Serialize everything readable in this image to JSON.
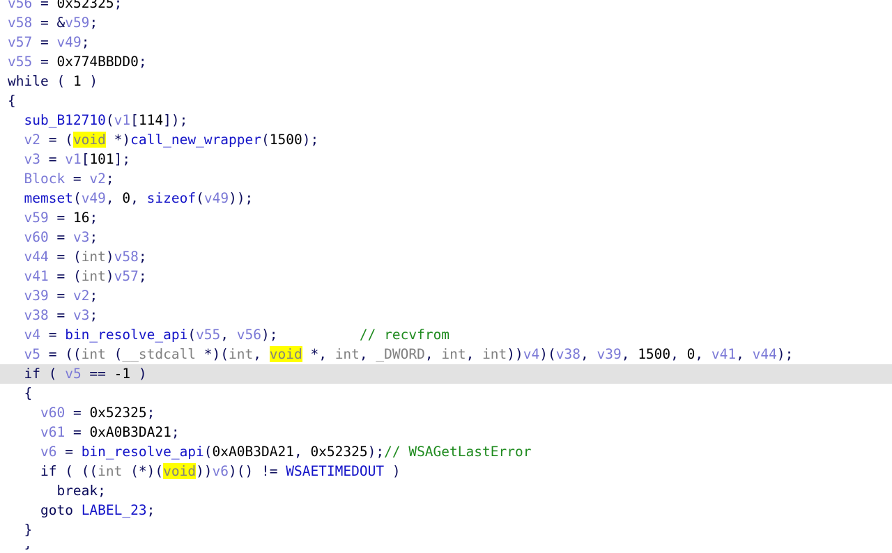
{
  "app": {
    "view_name": "hex-rays-pseudocode",
    "background": "#ffffff",
    "current_line_highlight": "#e2e2e2",
    "match_highlight": "#ffff00",
    "colors": {
      "variable": "#7a78d6",
      "function": "#1414c8",
      "keyword": "#0a0a5a",
      "type": "#808080",
      "number": "#000000",
      "comment": "#1f8b1f",
      "constant": "#1414c8"
    }
  },
  "code": {
    "highlighted_token": "void",
    "current_line_index": 19,
    "lines": [
      {
        "indent": 0,
        "clipped_top": true,
        "tokens": [
          {
            "t": "v56",
            "c": "var"
          },
          {
            "t": " = ",
            "c": "punct"
          },
          {
            "t": "0x52325",
            "c": "num"
          },
          {
            "t": ";",
            "c": "punct"
          }
        ]
      },
      {
        "indent": 0,
        "tokens": [
          {
            "t": "v58",
            "c": "var"
          },
          {
            "t": " = &",
            "c": "punct"
          },
          {
            "t": "v59",
            "c": "var"
          },
          {
            "t": ";",
            "c": "punct"
          }
        ]
      },
      {
        "indent": 0,
        "tokens": [
          {
            "t": "v57",
            "c": "var"
          },
          {
            "t": " = ",
            "c": "punct"
          },
          {
            "t": "v49",
            "c": "var"
          },
          {
            "t": ";",
            "c": "punct"
          }
        ]
      },
      {
        "indent": 0,
        "tokens": [
          {
            "t": "v55",
            "c": "var"
          },
          {
            "t": " = ",
            "c": "punct"
          },
          {
            "t": "0x774BBDD0",
            "c": "num"
          },
          {
            "t": ";",
            "c": "punct"
          }
        ]
      },
      {
        "indent": 0,
        "tokens": [
          {
            "t": "while",
            "c": "keyword"
          },
          {
            "t": " ( ",
            "c": "punct"
          },
          {
            "t": "1",
            "c": "num"
          },
          {
            "t": " )",
            "c": "punct"
          }
        ]
      },
      {
        "indent": 0,
        "tokens": [
          {
            "t": "{",
            "c": "punct"
          }
        ]
      },
      {
        "indent": 2,
        "tokens": [
          {
            "t": "sub_B12710",
            "c": "func"
          },
          {
            "t": "(",
            "c": "punct"
          },
          {
            "t": "v1",
            "c": "var"
          },
          {
            "t": "[",
            "c": "punct"
          },
          {
            "t": "114",
            "c": "num"
          },
          {
            "t": "]);",
            "c": "punct"
          }
        ]
      },
      {
        "indent": 2,
        "tokens": [
          {
            "t": "v2",
            "c": "var"
          },
          {
            "t": " = (",
            "c": "punct"
          },
          {
            "t": "void",
            "c": "type",
            "hl": true
          },
          {
            "t": " *)",
            "c": "punct"
          },
          {
            "t": "call_new_wrapper",
            "c": "func"
          },
          {
            "t": "(",
            "c": "punct"
          },
          {
            "t": "1500",
            "c": "num"
          },
          {
            "t": ");",
            "c": "punct"
          }
        ]
      },
      {
        "indent": 2,
        "tokens": [
          {
            "t": "v3",
            "c": "var"
          },
          {
            "t": " = ",
            "c": "punct"
          },
          {
            "t": "v1",
            "c": "var"
          },
          {
            "t": "[",
            "c": "punct"
          },
          {
            "t": "101",
            "c": "num"
          },
          {
            "t": "];",
            "c": "punct"
          }
        ]
      },
      {
        "indent": 2,
        "tokens": [
          {
            "t": "Block",
            "c": "var"
          },
          {
            "t": " = ",
            "c": "punct"
          },
          {
            "t": "v2",
            "c": "var"
          },
          {
            "t": ";",
            "c": "punct"
          }
        ]
      },
      {
        "indent": 2,
        "tokens": [
          {
            "t": "memset",
            "c": "func"
          },
          {
            "t": "(",
            "c": "punct"
          },
          {
            "t": "v49",
            "c": "var"
          },
          {
            "t": ", ",
            "c": "punct"
          },
          {
            "t": "0",
            "c": "num"
          },
          {
            "t": ", ",
            "c": "punct"
          },
          {
            "t": "sizeof",
            "c": "func"
          },
          {
            "t": "(",
            "c": "punct"
          },
          {
            "t": "v49",
            "c": "var"
          },
          {
            "t": "));",
            "c": "punct"
          }
        ]
      },
      {
        "indent": 2,
        "tokens": [
          {
            "t": "v59",
            "c": "var"
          },
          {
            "t": " = ",
            "c": "punct"
          },
          {
            "t": "16",
            "c": "num"
          },
          {
            "t": ";",
            "c": "punct"
          }
        ]
      },
      {
        "indent": 2,
        "tokens": [
          {
            "t": "v60",
            "c": "var"
          },
          {
            "t": " = ",
            "c": "punct"
          },
          {
            "t": "v3",
            "c": "var"
          },
          {
            "t": ";",
            "c": "punct"
          }
        ]
      },
      {
        "indent": 2,
        "tokens": [
          {
            "t": "v44",
            "c": "var"
          },
          {
            "t": " = (",
            "c": "punct"
          },
          {
            "t": "int",
            "c": "type"
          },
          {
            "t": ")",
            "c": "punct"
          },
          {
            "t": "v58",
            "c": "var"
          },
          {
            "t": ";",
            "c": "punct"
          }
        ]
      },
      {
        "indent": 2,
        "tokens": [
          {
            "t": "v41",
            "c": "var"
          },
          {
            "t": " = (",
            "c": "punct"
          },
          {
            "t": "int",
            "c": "type"
          },
          {
            "t": ")",
            "c": "punct"
          },
          {
            "t": "v57",
            "c": "var"
          },
          {
            "t": ";",
            "c": "punct"
          }
        ]
      },
      {
        "indent": 2,
        "tokens": [
          {
            "t": "v39",
            "c": "var"
          },
          {
            "t": " = ",
            "c": "punct"
          },
          {
            "t": "v2",
            "c": "var"
          },
          {
            "t": ";",
            "c": "punct"
          }
        ]
      },
      {
        "indent": 2,
        "tokens": [
          {
            "t": "v38",
            "c": "var"
          },
          {
            "t": " = ",
            "c": "punct"
          },
          {
            "t": "v3",
            "c": "var"
          },
          {
            "t": ";",
            "c": "punct"
          }
        ]
      },
      {
        "indent": 2,
        "tokens": [
          {
            "t": "v4",
            "c": "var"
          },
          {
            "t": " = ",
            "c": "punct"
          },
          {
            "t": "bin_resolve_api",
            "c": "func"
          },
          {
            "t": "(",
            "c": "punct"
          },
          {
            "t": "v55",
            "c": "var"
          },
          {
            "t": ", ",
            "c": "punct"
          },
          {
            "t": "v56",
            "c": "var"
          },
          {
            "t": ");",
            "c": "punct"
          },
          {
            "t": "          ",
            "c": "punct"
          },
          {
            "t": "// recvfrom",
            "c": "comment"
          }
        ]
      },
      {
        "indent": 2,
        "tokens": [
          {
            "t": "v5",
            "c": "var"
          },
          {
            "t": " = ((",
            "c": "punct"
          },
          {
            "t": "int",
            "c": "type"
          },
          {
            "t": " (",
            "c": "punct"
          },
          {
            "t": "__stdcall",
            "c": "type"
          },
          {
            "t": " *)(",
            "c": "punct"
          },
          {
            "t": "int",
            "c": "type"
          },
          {
            "t": ", ",
            "c": "punct"
          },
          {
            "t": "void",
            "c": "type",
            "hl": true
          },
          {
            "t": " *, ",
            "c": "punct"
          },
          {
            "t": "int",
            "c": "type"
          },
          {
            "t": ", ",
            "c": "punct"
          },
          {
            "t": "_DWORD",
            "c": "type"
          },
          {
            "t": ", ",
            "c": "punct"
          },
          {
            "t": "int",
            "c": "type"
          },
          {
            "t": ", ",
            "c": "punct"
          },
          {
            "t": "int",
            "c": "type"
          },
          {
            "t": "))",
            "c": "punct"
          },
          {
            "t": "v4",
            "c": "var"
          },
          {
            "t": ")(",
            "c": "punct"
          },
          {
            "t": "v38",
            "c": "var"
          },
          {
            "t": ", ",
            "c": "punct"
          },
          {
            "t": "v39",
            "c": "var"
          },
          {
            "t": ", ",
            "c": "punct"
          },
          {
            "t": "1500",
            "c": "num"
          },
          {
            "t": ", ",
            "c": "punct"
          },
          {
            "t": "0",
            "c": "num"
          },
          {
            "t": ", ",
            "c": "punct"
          },
          {
            "t": "v41",
            "c": "var"
          },
          {
            "t": ", ",
            "c": "punct"
          },
          {
            "t": "v44",
            "c": "var"
          },
          {
            "t": ");",
            "c": "punct"
          }
        ]
      },
      {
        "indent": 2,
        "current": true,
        "tokens": [
          {
            "t": "if",
            "c": "keyword"
          },
          {
            "t": " ( ",
            "c": "punct"
          },
          {
            "t": "v5",
            "c": "var"
          },
          {
            "t": " == ",
            "c": "punct"
          },
          {
            "t": "-1",
            "c": "num"
          },
          {
            "t": " )",
            "c": "punct"
          }
        ]
      },
      {
        "indent": 2,
        "tokens": [
          {
            "t": "{",
            "c": "punct"
          }
        ]
      },
      {
        "indent": 4,
        "tokens": [
          {
            "t": "v60",
            "c": "var"
          },
          {
            "t": " = ",
            "c": "punct"
          },
          {
            "t": "0x52325",
            "c": "num"
          },
          {
            "t": ";",
            "c": "punct"
          }
        ]
      },
      {
        "indent": 4,
        "tokens": [
          {
            "t": "v61",
            "c": "var"
          },
          {
            "t": " = ",
            "c": "punct"
          },
          {
            "t": "0xA0B3DA21",
            "c": "num"
          },
          {
            "t": ";",
            "c": "punct"
          }
        ]
      },
      {
        "indent": 4,
        "tokens": [
          {
            "t": "v6",
            "c": "var"
          },
          {
            "t": " = ",
            "c": "punct"
          },
          {
            "t": "bin_resolve_api",
            "c": "func"
          },
          {
            "t": "(",
            "c": "punct"
          },
          {
            "t": "0xA0B3DA21",
            "c": "num"
          },
          {
            "t": ", ",
            "c": "punct"
          },
          {
            "t": "0x52325",
            "c": "num"
          },
          {
            "t": ");",
            "c": "punct"
          },
          {
            "t": "// WSAGetLastError",
            "c": "comment"
          }
        ]
      },
      {
        "indent": 4,
        "tokens": [
          {
            "t": "if",
            "c": "keyword"
          },
          {
            "t": " ( ((",
            "c": "punct"
          },
          {
            "t": "int",
            "c": "type"
          },
          {
            "t": " (*)(",
            "c": "punct"
          },
          {
            "t": "void",
            "c": "type",
            "hl": true
          },
          {
            "t": "))",
            "c": "punct"
          },
          {
            "t": "v6",
            "c": "var"
          },
          {
            "t": ")() != ",
            "c": "punct"
          },
          {
            "t": "WSAETIMEDOUT",
            "c": "const"
          },
          {
            "t": " )",
            "c": "punct"
          }
        ]
      },
      {
        "indent": 6,
        "tokens": [
          {
            "t": "break",
            "c": "keyword"
          },
          {
            "t": ";",
            "c": "punct"
          }
        ]
      },
      {
        "indent": 4,
        "tokens": [
          {
            "t": "goto",
            "c": "keyword"
          },
          {
            "t": " ",
            "c": "punct"
          },
          {
            "t": "LABEL_23",
            "c": "const"
          },
          {
            "t": ";",
            "c": "punct"
          }
        ]
      },
      {
        "indent": 2,
        "tokens": [
          {
            "t": "}",
            "c": "punct"
          }
        ]
      }
    ],
    "clipped_bottom_line": {
      "indent": 2,
      "tokens": [
        {
          "t": "}",
          "c": "punct"
        }
      ]
    }
  }
}
